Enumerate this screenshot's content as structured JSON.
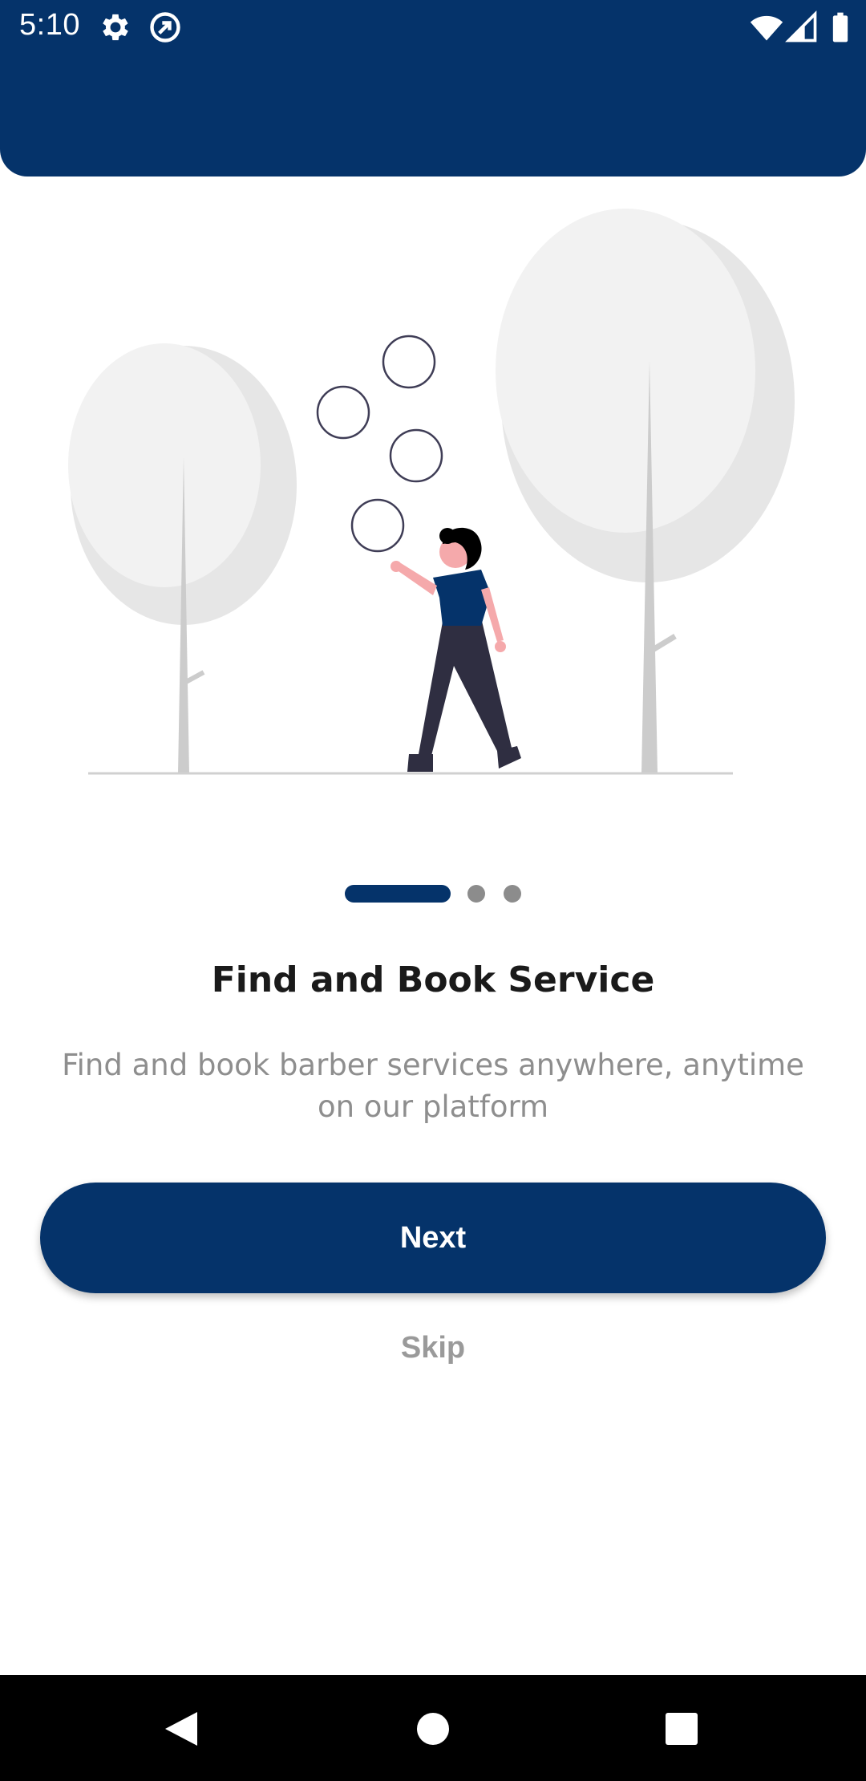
{
  "status_bar": {
    "time": "5:10",
    "left_icons": [
      "settings-gear-icon",
      "at-sign-icon"
    ],
    "right_icons": [
      "wifi-icon",
      "cell-signal-icon",
      "battery-icon"
    ]
  },
  "colors": {
    "primary": "#05336a",
    "title_text": "#1a1a1a",
    "muted_text": "#8e8e8e",
    "inactive_dot": "#8c8c8c",
    "tree_light": "#f2f2f2",
    "tree_shade": "#e6e6e6",
    "trunk": "#cccccc",
    "skin": "#f5a9ab",
    "pants": "#2f2e41"
  },
  "onboarding": {
    "illustration": "person-blowing-bubbles-with-trees",
    "page_indicator": {
      "total": 3,
      "current": 1
    },
    "title": "Find and Book Service",
    "description": "Find and book barber services anywhere, anytime on our platform",
    "next_label": "Next",
    "skip_label": "Skip"
  },
  "nav_bar": {
    "buttons": [
      "back-triangle-icon",
      "home-circle-icon",
      "recents-square-icon"
    ]
  }
}
